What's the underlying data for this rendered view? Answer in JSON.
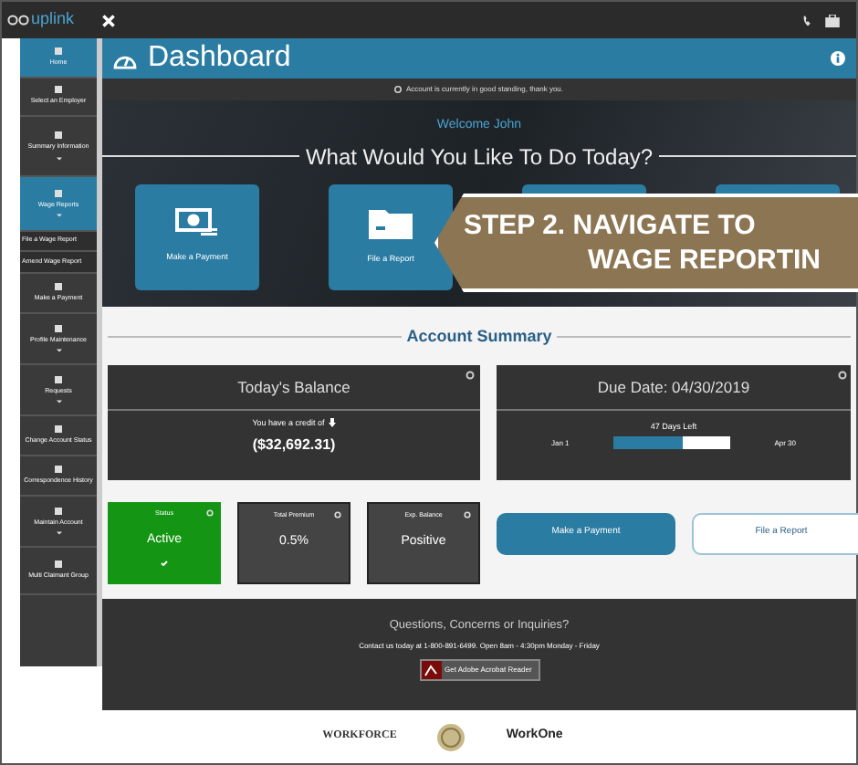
{
  "app": {
    "logo": "uplink"
  },
  "sidebar": {
    "items": [
      {
        "kind": "main",
        "label": "Home",
        "selected": true,
        "expandable": false
      },
      {
        "kind": "main",
        "label": "Select an Employer",
        "selected": false,
        "expandable": false
      },
      {
        "kind": "main",
        "label": "Summary Information",
        "selected": false,
        "expandable": true
      },
      {
        "kind": "main",
        "label": "Wage Reports",
        "selected": true,
        "expandable": true
      },
      {
        "kind": "sub",
        "label": "File a Wage Report",
        "selected": false,
        "expandable": false
      },
      {
        "kind": "sub",
        "label": "Amend Wage Report",
        "selected": false,
        "expandable": false
      },
      {
        "kind": "main",
        "label": "Make a Payment",
        "selected": false,
        "expandable": false
      },
      {
        "kind": "main",
        "label": "Profile Maintenance",
        "selected": false,
        "expandable": true
      },
      {
        "kind": "main",
        "label": "Requests",
        "selected": false,
        "expandable": true
      },
      {
        "kind": "main",
        "label": "Change Account Status",
        "selected": false,
        "expandable": false
      },
      {
        "kind": "main",
        "label": "Correspondence History",
        "selected": false,
        "expandable": false
      },
      {
        "kind": "main",
        "label": "Maintain Account",
        "selected": false,
        "expandable": true
      },
      {
        "kind": "main",
        "label": "Multi Claimant Group",
        "selected": false,
        "expandable": false
      }
    ]
  },
  "page": {
    "title": "Dashboard",
    "notice": "Account is currently in good standing, thank you."
  },
  "hero": {
    "welcome": "Welcome John",
    "question": "What Would You Like To Do Today?",
    "tiles": [
      {
        "kind": "payment",
        "label": "Make a Payment"
      },
      {
        "kind": "report",
        "label": "File a Report"
      },
      {
        "kind": "blank"
      },
      {
        "kind": "blank"
      }
    ]
  },
  "callout": {
    "lines": [
      "STEP 2. NAVIGATE TO",
      "WAGE REPORTIN"
    ]
  },
  "summary": {
    "heading": "Account Summary",
    "balance": {
      "title": "Today's Balance",
      "note": "You have a credit of",
      "amount": "($32,692.31)"
    },
    "due": {
      "title": "Due Date: 04/30/2019",
      "days_left": "47 Days Left",
      "start": "Jan 1",
      "end": "Apr 30",
      "level": 0.6
    },
    "stats": [
      {
        "kind": "status",
        "label": "Status",
        "value": "Active"
      },
      {
        "kind": "plain",
        "label": "Total Premium",
        "value": "0.5%"
      },
      {
        "kind": "plain",
        "label": "Exp. Balance",
        "value": "Positive"
      }
    ],
    "buttons": [
      {
        "label": "Make a Payment",
        "primary": true
      },
      {
        "label": "File a Report",
        "primary": false
      }
    ]
  },
  "footer": {
    "heading": "Questions, Concerns or Inquiries?",
    "contact": "Contact us today at 1-800-891-6499. Open 8am - 4:30pm Monday - Friday",
    "badge": "Get Adobe Acrobat Reader"
  },
  "logos": [
    {
      "kind": "text",
      "text": "WORKFORCE"
    },
    {
      "kind": "seal"
    },
    {
      "kind": "text2",
      "text": "WorkOne"
    }
  ]
}
